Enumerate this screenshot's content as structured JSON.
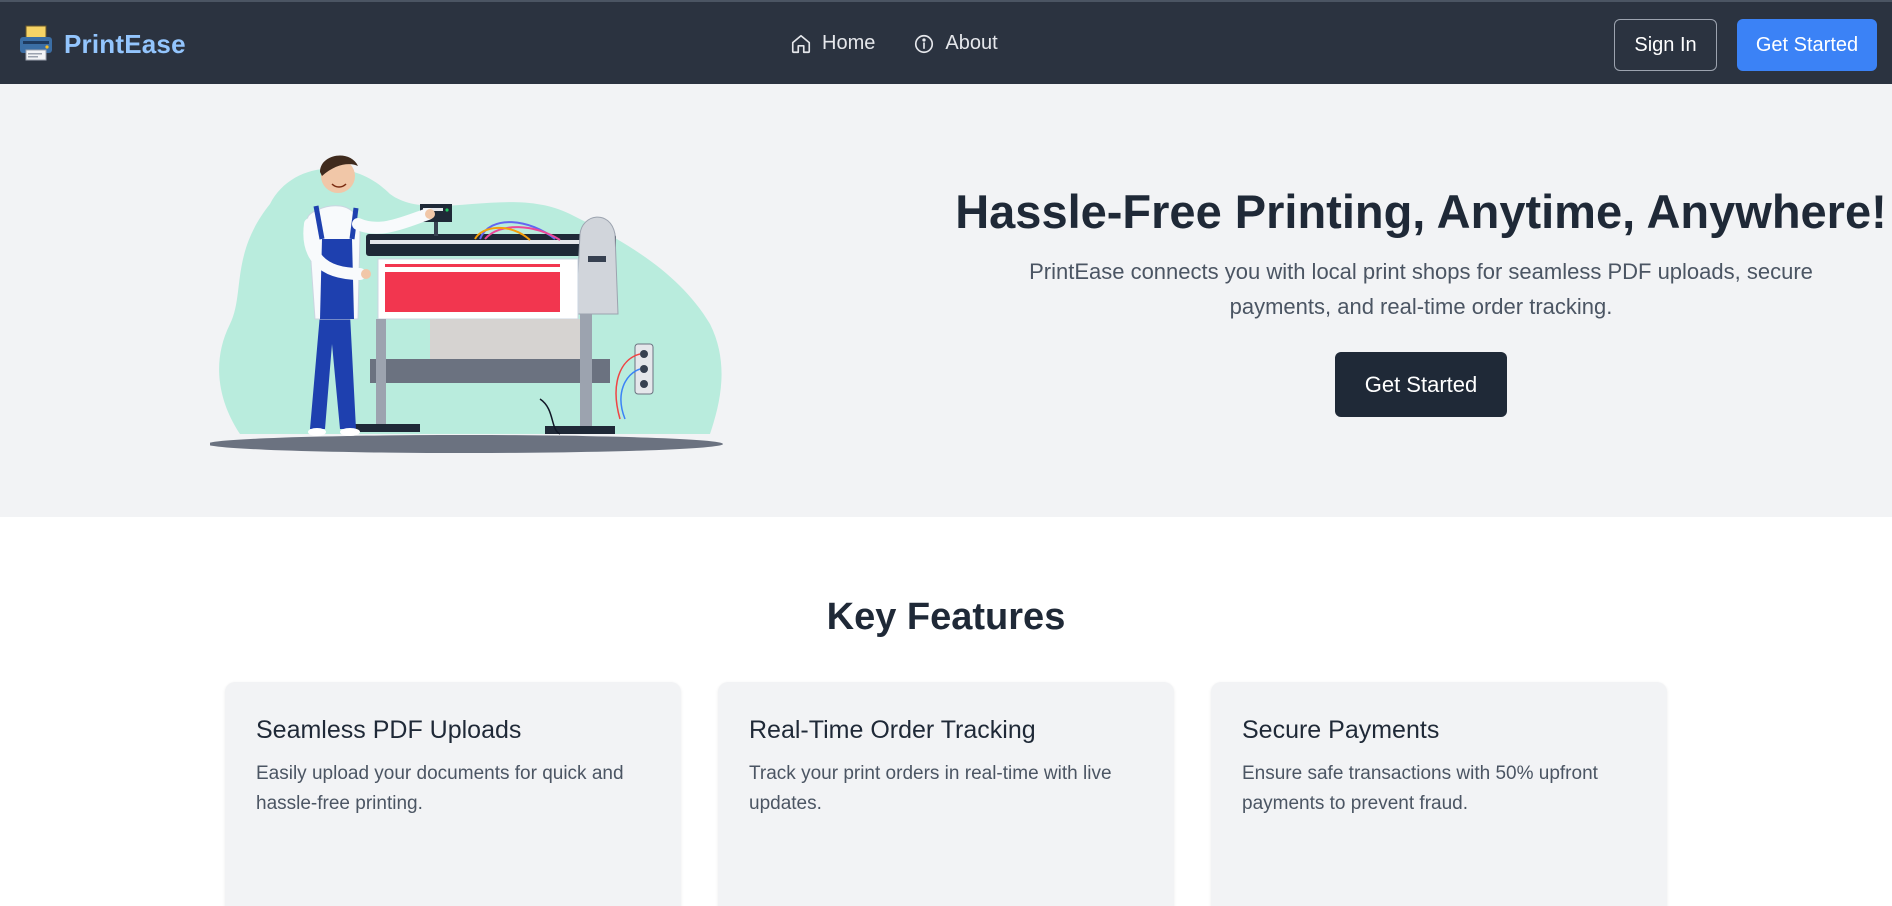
{
  "nav": {
    "brand": "PrintEase",
    "links": [
      {
        "label": "Home",
        "icon": "home-icon"
      },
      {
        "label": "About",
        "icon": "info-icon"
      }
    ],
    "signin_label": "Sign In",
    "getstarted_label": "Get Started"
  },
  "hero": {
    "title": "Hassle-Free Printing, Anytime, Anywhere!",
    "subtitle": "PrintEase connects you with local print shops for seamless PDF uploads, secure payments, and real-time order tracking.",
    "cta_label": "Get Started"
  },
  "features": {
    "title": "Key Features",
    "items": [
      {
        "title": "Seamless PDF Uploads",
        "description": "Easily upload your documents for quick and hassle-free printing."
      },
      {
        "title": "Real-Time Order Tracking",
        "description": "Track your print orders in real-time with live updates."
      },
      {
        "title": "Secure Payments",
        "description": "Ensure safe transactions with 50% upfront payments to prevent fraud."
      }
    ]
  },
  "colors": {
    "navbar_bg": "#2b3340",
    "brand": "#93c5fd",
    "primary": "#3b82f6",
    "dark_button": "#1f2937",
    "hero_bg": "#f2f3f5",
    "blob": "#b9ecdd",
    "paper_red": "#f2364f"
  }
}
